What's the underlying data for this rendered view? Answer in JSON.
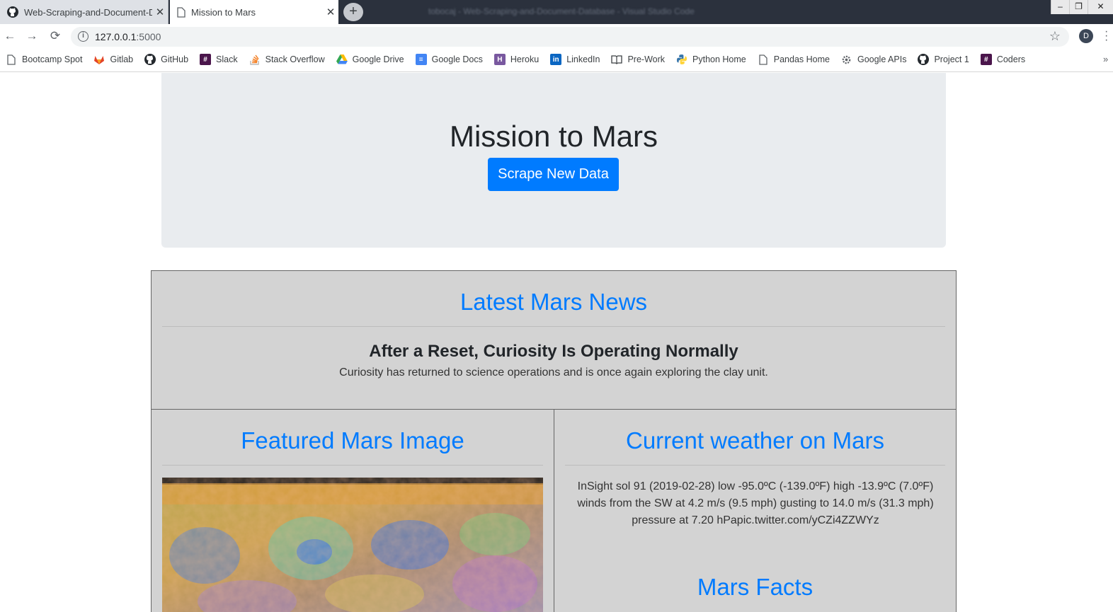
{
  "browser": {
    "tabs": [
      {
        "title": "Web-Scraping-and-Document-D",
        "icon": "github-icon",
        "active": false
      },
      {
        "title": "Mission to Mars",
        "icon": "page-icon",
        "active": true
      }
    ],
    "new_tab_label": "+",
    "window_title": "tobocaj - Web-Scraping-and-Document-Database - Visual Studio Code",
    "url_host": "127.0.0.1",
    "url_port": ":5000",
    "profile_initial": "D",
    "bookmarks": [
      {
        "label": "Bootcamp Spot",
        "icon": "page-icon"
      },
      {
        "label": "Gitlab",
        "icon": "gitlab-icon"
      },
      {
        "label": "GitHub",
        "icon": "github-icon"
      },
      {
        "label": "Slack",
        "icon": "slack-icon"
      },
      {
        "label": "Stack Overflow",
        "icon": "stackoverflow-icon"
      },
      {
        "label": "Google Drive",
        "icon": "google-drive-icon"
      },
      {
        "label": "Google Docs",
        "icon": "google-docs-icon"
      },
      {
        "label": "Heroku",
        "icon": "heroku-icon"
      },
      {
        "label": "LinkedIn",
        "icon": "linkedin-icon"
      },
      {
        "label": "Pre-Work",
        "icon": "book-icon"
      },
      {
        "label": "Python Home",
        "icon": "python-icon"
      },
      {
        "label": "Pandas Home",
        "icon": "page-icon"
      },
      {
        "label": "Google APIs",
        "icon": "gear-icon"
      },
      {
        "label": "Project 1",
        "icon": "github-icon"
      },
      {
        "label": "Coders",
        "icon": "slack-icon"
      }
    ],
    "more_bookmarks": "»"
  },
  "page": {
    "title": "Mission to Mars",
    "scrape_button": "Scrape New Data",
    "news": {
      "heading": "Latest Mars News",
      "title": "After a Reset, Curiosity Is Operating Normally",
      "paragraph": "Curiosity has returned to science operations and is once again exploring the clay unit."
    },
    "featured_image": {
      "heading": "Featured Mars Image"
    },
    "weather": {
      "heading": "Current weather on Mars",
      "text": "InSight sol 91 (2019-02-28) low -95.0ºC (-139.0ºF) high -13.9ºC (7.0ºF) winds from the SW at 4.2 m/s (9.5 mph) gusting to 14.0 m/s (31.3 mph) pressure at 7.20 hPapic.twitter.com/yCZi4ZZWYz"
    },
    "facts": {
      "heading": "Mars Facts"
    }
  },
  "colors": {
    "accent": "#007bff",
    "jumbotron_bg": "#e9ecef",
    "card_bg": "#d3d3d3",
    "titlebar": "#2b313d"
  }
}
